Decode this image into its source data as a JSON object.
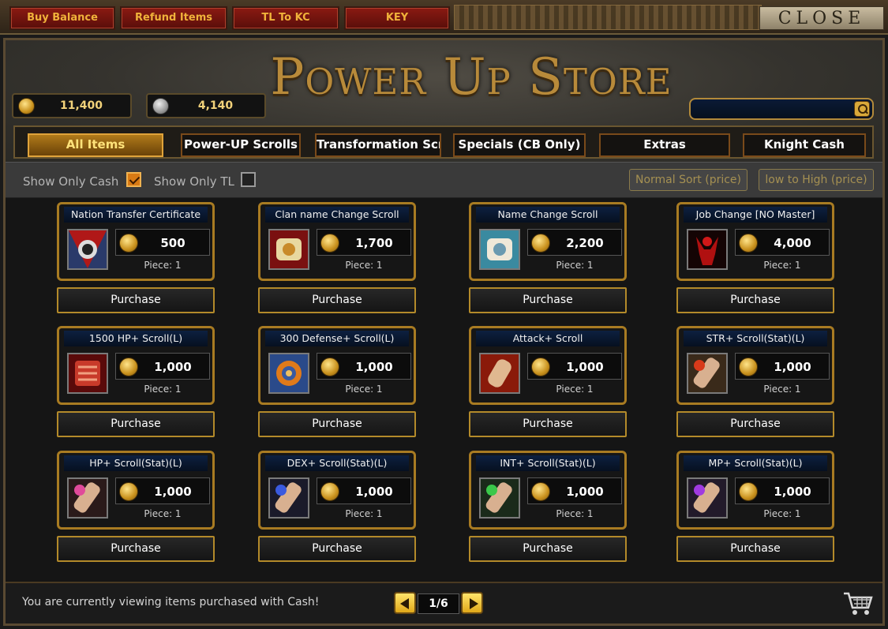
{
  "topbar": {
    "buttons": [
      "Buy Balance",
      "Refund Items",
      "TL To KC",
      "KEY"
    ],
    "close_label": "CLOSE"
  },
  "header": {
    "title": "Power Up Store",
    "gold_balance": "11,400",
    "silver_balance": "4,140",
    "search_placeholder": ""
  },
  "tabs": [
    {
      "label": "All Items",
      "active": true
    },
    {
      "label": "Power-UP Scrolls",
      "active": false
    },
    {
      "label": "Transformation Scr",
      "active": false
    },
    {
      "label": "Specials (CB Only)",
      "active": false
    },
    {
      "label": "Extras",
      "active": false
    },
    {
      "label": "Knight Cash",
      "active": false
    }
  ],
  "filters": {
    "cash_label": "Show Only Cash",
    "cash_checked": true,
    "tl_label": "Show Only TL",
    "tl_checked": false,
    "sort_normal": "Normal Sort (price)",
    "sort_low_high": "low to High (price)"
  },
  "purchase_label": "Purchase",
  "items": [
    {
      "name": "Nation Transfer Certificate",
      "price": "500",
      "piece": "Piece: 1",
      "icon": "nation-transfer-icon"
    },
    {
      "name": "Clan name Change Scroll",
      "price": "1,700",
      "piece": "Piece: 1",
      "icon": "clan-scroll-icon"
    },
    {
      "name": "Name Change Scroll",
      "price": "2,200",
      "piece": "Piece: 1",
      "icon": "name-scroll-icon"
    },
    {
      "name": "Job Change [NO Master]",
      "price": "4,000",
      "piece": "Piece: 1",
      "icon": "job-change-icon"
    },
    {
      "name": "1500 HP+ Scroll(L)",
      "price": "1,000",
      "piece": "Piece: 1",
      "icon": "hp-scroll-icon"
    },
    {
      "name": "300 Defense+ Scroll(L)",
      "price": "1,000",
      "piece": "Piece: 1",
      "icon": "defense-scroll-icon"
    },
    {
      "name": "Attack+ Scroll",
      "price": "1,000",
      "piece": "Piece: 1",
      "icon": "attack-scroll-icon"
    },
    {
      "name": "STR+ Scroll(Stat)(L)",
      "price": "1,000",
      "piece": "Piece: 1",
      "icon": "str-scroll-icon"
    },
    {
      "name": "HP+ Scroll(Stat)(L)",
      "price": "1,000",
      "piece": "Piece: 1",
      "icon": "hp-stat-scroll-icon"
    },
    {
      "name": "DEX+ Scroll(Stat)(L)",
      "price": "1,000",
      "piece": "Piece: 1",
      "icon": "dex-scroll-icon"
    },
    {
      "name": "INT+ Scroll(Stat)(L)",
      "price": "1,000",
      "piece": "Piece: 1",
      "icon": "int-scroll-icon"
    },
    {
      "name": "MP+ Scroll(Stat)(L)",
      "price": "1,000",
      "piece": "Piece: 1",
      "icon": "mp-scroll-icon"
    }
  ],
  "footer": {
    "message": "You are currently viewing items purchased with Cash!",
    "page": "1/6"
  },
  "colors": {
    "accent_gold": "#a87b22",
    "tab_active": "#b07a1a",
    "top_button_red": "#8a1a12"
  }
}
